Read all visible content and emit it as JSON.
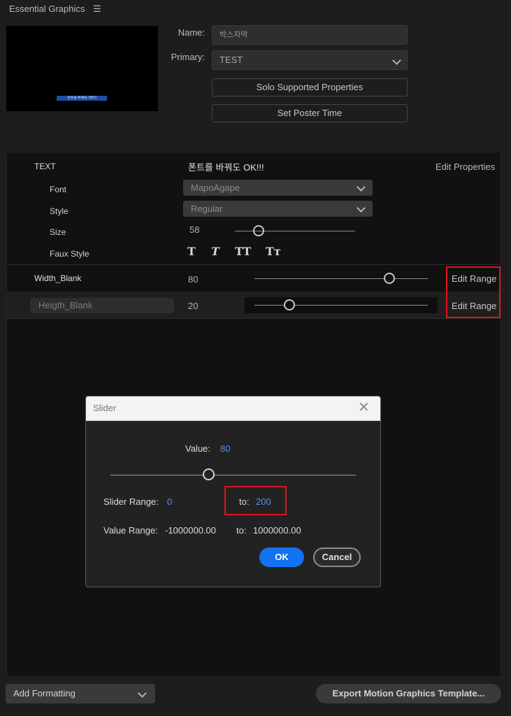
{
  "panel": {
    "title": "Essential Graphics"
  },
  "preview": {
    "caption": "폰트를 바꿔도 OK!!!"
  },
  "fields": {
    "name_label": "Name:",
    "name_value": "박스자막",
    "primary_label": "Primary:",
    "primary_value": "TEST"
  },
  "buttons": {
    "solo": "Solo Supported Properties",
    "poster": "Set Poster Time"
  },
  "props": {
    "text_label": "TEXT",
    "text_value": "폰트를 바꿔도 OK!!!",
    "edit_properties": "Edit Properties",
    "font_label": "Font",
    "font_value": "MapoAgape",
    "style_label": "Style",
    "style_value": "Regular",
    "size_label": "Size",
    "size_value": "58",
    "size_level": 0.2,
    "faux_label": "Faux Style",
    "faux_glyphs": [
      "T",
      "T",
      "TT",
      "Tт"
    ],
    "width_label": "Width_Blank",
    "width_value": "80",
    "width_level": 0.78,
    "edit_range_1": "Edit Range",
    "heigth_label": "Heigth_Blank",
    "heigth_value": "20",
    "heigth_level": 0.2,
    "edit_range_2": "Edit Range"
  },
  "dialog": {
    "title": "Slider",
    "value_label": "Value:",
    "value": "80",
    "slider_level": 0.4,
    "slider_range_label": "Slider Range:",
    "slider_range_from": "0",
    "to_label": "to:",
    "slider_range_to": "200",
    "value_range_label": "Value Range:",
    "value_range_from": "-1000000.00",
    "value_range_to_label": "to:",
    "value_range_to": "1000000.00",
    "ok": "OK",
    "cancel": "Cancel"
  },
  "footer": {
    "add_formatting": "Add Formatting",
    "export": "Export Motion Graphics Template..."
  },
  "colors": {
    "accent": "#1272f0",
    "highlight": "#e0131e",
    "link": "#4c95f0"
  }
}
